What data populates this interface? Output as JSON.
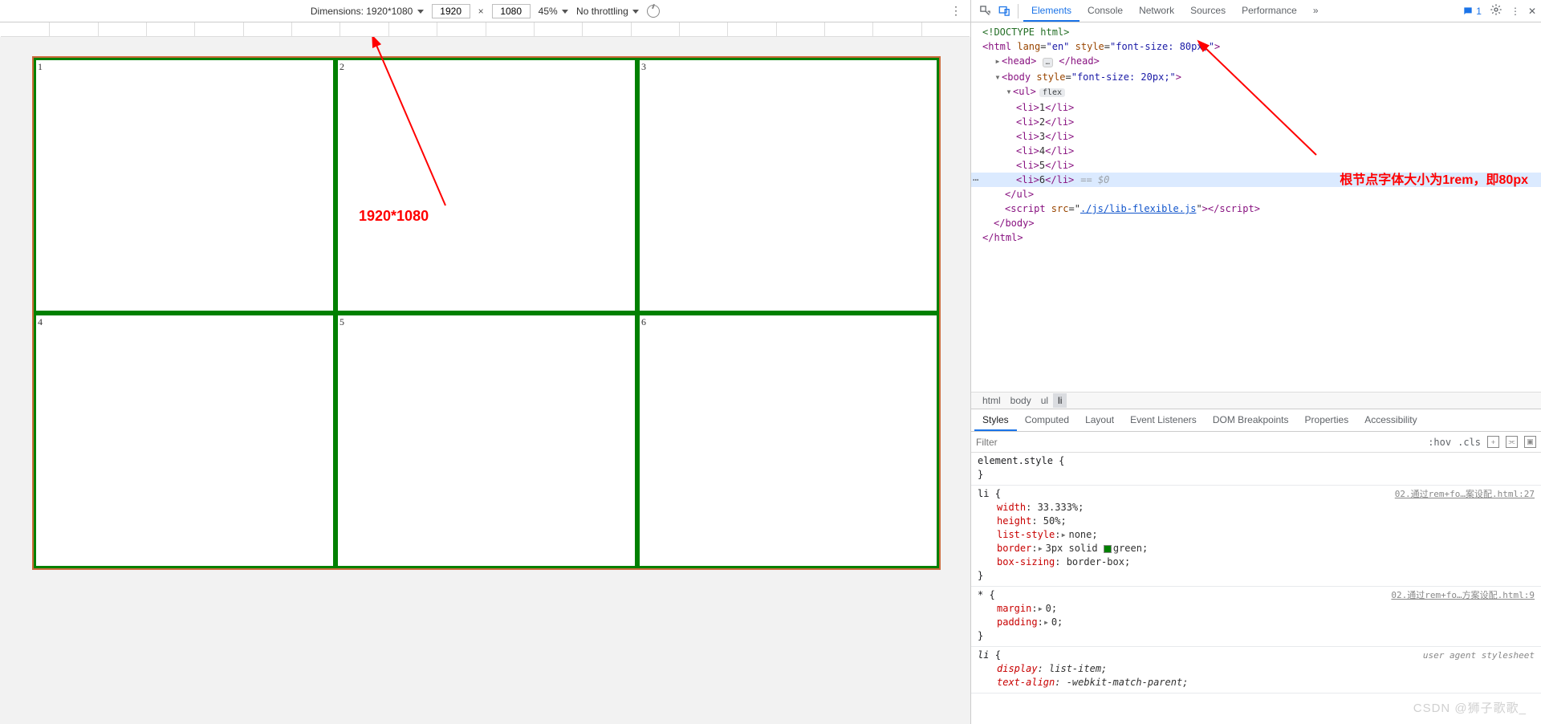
{
  "device_toolbar": {
    "dimensions_label": "Dimensions: 1920*1080",
    "width_value": "1920",
    "height_value": "1080",
    "zoom_label": "45%",
    "throttling_label": "No throttling",
    "sep": "×"
  },
  "page_grid": {
    "cells": [
      "1",
      "2",
      "3",
      "4",
      "5",
      "6"
    ]
  },
  "anno_left_text": "1920*1080",
  "anno_right_text": "根节点字体大小为1rem，即80px",
  "devtools_tabs": {
    "items": [
      "Elements",
      "Console",
      "Network",
      "Sources",
      "Performance"
    ],
    "more": "»",
    "message_count": "1"
  },
  "dom": {
    "doctype": "<!DOCTYPE html>",
    "html_open_pre": "<html ",
    "html_lang_name": "lang",
    "html_lang_val": "\"en\"",
    "html_style_name": "style",
    "html_style_val": "\"font-size: 80px;\"",
    "html_open_post": ">",
    "head_open": "<head>",
    "head_ell": "…",
    "head_close": "</head>",
    "body_open_pre": "<body ",
    "body_style_name": "style",
    "body_style_val": "\"font-size: 20px;\"",
    "body_open_post": ">",
    "ul_open": "<ul>",
    "flex_badge": "flex",
    "li1_o": "<li>",
    "li1_t": "1",
    "li1_c": "</li>",
    "li2_o": "<li>",
    "li2_t": "2",
    "li2_c": "</li>",
    "li3_o": "<li>",
    "li3_t": "3",
    "li3_c": "</li>",
    "li4_o": "<li>",
    "li4_t": "4",
    "li4_c": "</li>",
    "li5_o": "<li>",
    "li5_t": "5",
    "li5_c": "</li>",
    "li6_o": "<li>",
    "li6_t": "6",
    "li6_c": "</li>",
    "dollar0": "== $0",
    "ul_close": "</ul>",
    "script_open": "<script ",
    "script_src_name": "src",
    "script_src_val": "./js/lib-flexible.js",
    "script_close": "></script>",
    "body_close": "</body>",
    "html_close": "</html>"
  },
  "breadcrumb": {
    "items": [
      "html",
      "body",
      "ul",
      "li"
    ]
  },
  "styles_tabs": [
    "Styles",
    "Computed",
    "Layout",
    "Event Listeners",
    "DOM Breakpoints",
    "Properties",
    "Accessibility"
  ],
  "filter_placeholder": "Filter",
  "filter_hov": ":hov",
  "filter_cls": ".cls",
  "rules": {
    "r0": {
      "sel": "element.style ",
      "ob": "{",
      "cb": "}"
    },
    "r1": {
      "source": "02.通过rem+fo…案设配.html:27",
      "sel": "li ",
      "ob": "{",
      "cb": "}",
      "p1n": "width",
      "p1v": ": 33.333%;",
      "p2n": "height",
      "p2v": ": 50%;",
      "p3n": "list-style",
      "p3v": "none;",
      "p4n": "border",
      "p4v": "3px solid ",
      "p4v2": "green;",
      "p5n": "box-sizing",
      "p5v": ": border-box;"
    },
    "r2": {
      "source": "02.通过rem+fo…方案设配.html:9",
      "sel": "* ",
      "ob": "{",
      "cb": "}",
      "p1n": "margin",
      "p1v": "0;",
      "p2n": "padding",
      "p2v": "0;"
    },
    "r3": {
      "source": "user agent stylesheet",
      "sel": "li ",
      "ob": "{",
      "p1n": "display",
      "p1v": ": list-item;",
      "p2n": "text-align",
      "p2v": ": -webkit-match-parent;"
    }
  },
  "watermark": "CSDN @狮子歌歌_"
}
